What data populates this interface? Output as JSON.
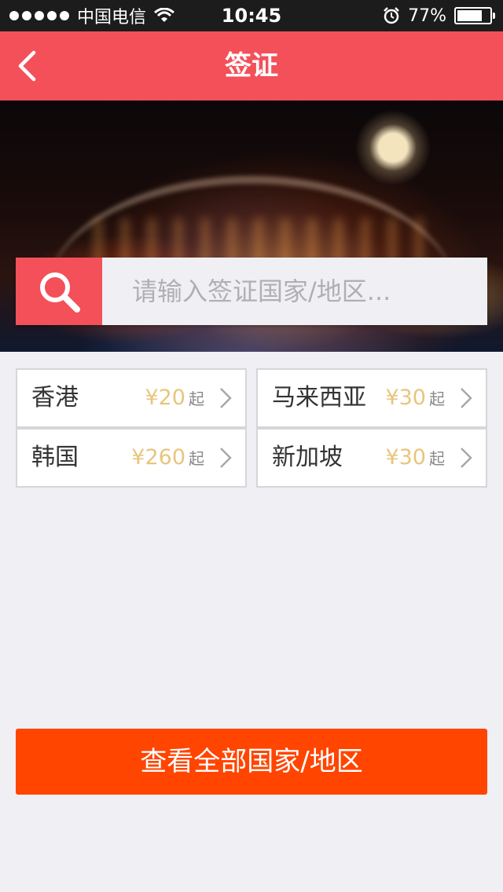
{
  "status_bar": {
    "carrier": "中国电信",
    "time": "10:45",
    "battery": "77%",
    "battery_level": 0.77
  },
  "nav": {
    "title": "签证"
  },
  "search": {
    "placeholder": "请输入签证国家/地区..."
  },
  "destinations": [
    {
      "name": "香港",
      "price": "¥20",
      "suffix": "起"
    },
    {
      "name": "马来西亚",
      "price": "¥30",
      "suffix": "起"
    },
    {
      "name": "韩国",
      "price": "¥260",
      "suffix": "起"
    },
    {
      "name": "新加坡",
      "price": "¥30",
      "suffix": "起"
    }
  ],
  "view_all": {
    "label": "查看全部国家/地区"
  },
  "colors": {
    "primary": "#f4505a",
    "cta": "#ff4500",
    "price": "#e8c57d",
    "background": "#efeff4"
  },
  "icons": [
    "wifi-icon",
    "alarm-icon",
    "battery-icon",
    "back-icon",
    "search-icon",
    "chevron-right-icon"
  ]
}
